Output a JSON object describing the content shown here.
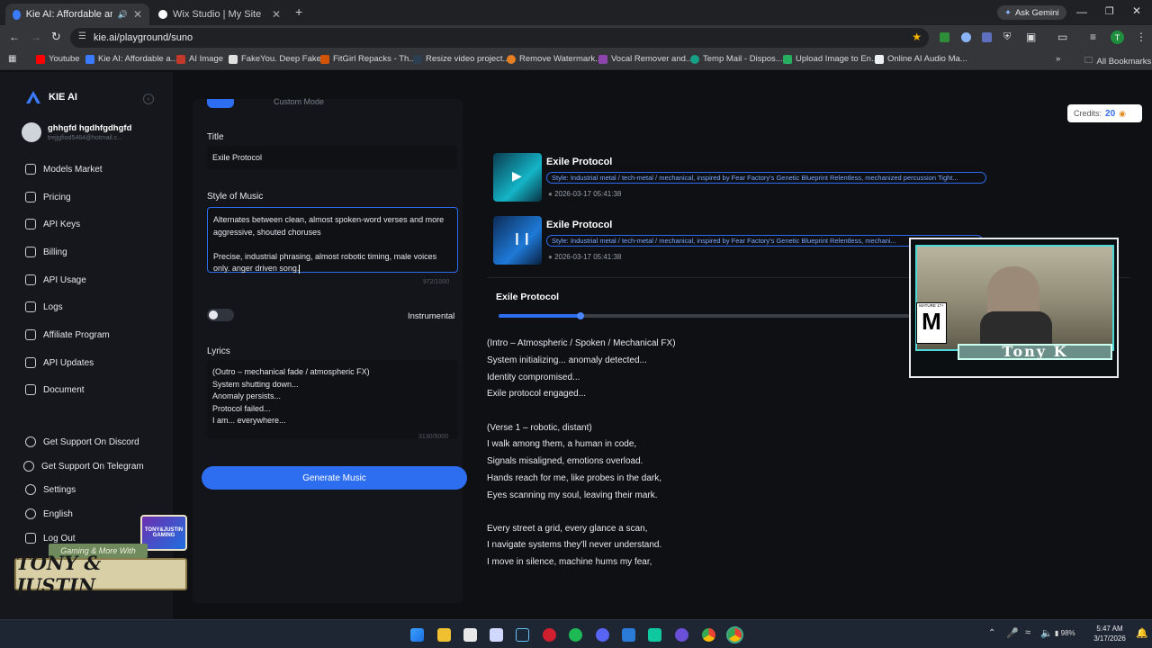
{
  "browser": {
    "tabs": [
      {
        "label": "Kie AI: Affordable and Stal"
      },
      {
        "label": "Wix Studio | My Site"
      }
    ],
    "new_tab_label": "+",
    "url": "kie.ai/playground/suno",
    "ask_gemini": "Ask Gemini",
    "profile_initial": "T",
    "bookmarks": [
      {
        "label": "Youtube"
      },
      {
        "label": "Kie AI: Affordable a..."
      },
      {
        "label": "AI Image"
      },
      {
        "label": "FakeYou. Deep Fake..."
      },
      {
        "label": "FitGirl Repacks - Th..."
      },
      {
        "label": "Resize video project..."
      },
      {
        "label": "Remove Watermark..."
      },
      {
        "label": "Vocal Remover and..."
      },
      {
        "label": "Temp Mail - Dispos..."
      },
      {
        "label": "Upload Image to En..."
      },
      {
        "label": "Online AI Audio Ma..."
      }
    ],
    "all_bookmarks": "All Bookmarks"
  },
  "sidebar": {
    "brand": "KIE AI",
    "user_name": "ghhgfd hgdhfgdhgfd",
    "user_email": "trejjgfiod5464@hotmail.c...",
    "nav": [
      {
        "label": "Models Market"
      },
      {
        "label": "Pricing"
      },
      {
        "label": "API Keys"
      },
      {
        "label": "Billing"
      },
      {
        "label": "API Usage"
      },
      {
        "label": "Logs"
      },
      {
        "label": "Affiliate Program"
      },
      {
        "label": "API Updates"
      },
      {
        "label": "Document"
      }
    ],
    "bottom": [
      {
        "label": "Get Support On Discord"
      },
      {
        "label": "Get Support On Telegram"
      },
      {
        "label": "Settings"
      },
      {
        "label": "English"
      },
      {
        "label": "Log Out"
      }
    ]
  },
  "form": {
    "custom_mode_label": "Custom Mode",
    "title_label": "Title",
    "title_value": "Exile Protocol",
    "style_label": "Style of Music",
    "style_lines": [
      "Alternates between clean, almost spoken-word verses and more",
      "aggressive, shouted choruses",
      "",
      "Precise, industrial phrasing, almost robotic timing, male voices",
      "only. anger driven song."
    ],
    "style_counter": "972/1000",
    "instrumental_label": "Instrumental",
    "lyrics_label": "Lyrics",
    "lyrics_lines": [
      "(Outro – mechanical fade / atmospheric FX)",
      "System shutting down...",
      "Anomaly persists...",
      "Protocol failed...",
      "I am... everywhere..."
    ],
    "lyrics_counter": "3130/5000",
    "generate_label": "Generate Music"
  },
  "credits": {
    "label": "Credits:",
    "value": "20"
  },
  "songs": [
    {
      "title": "Exile Protocol",
      "style": "Style: Industrial metal / tech-metal / mechanical, inspired by Fear Factory's Genetic Blueprint Relentless, mechanized percussion Tight...",
      "date": "2026-03-17 05:41:38"
    },
    {
      "title": "Exile Protocol",
      "style": "Style: Industrial metal / tech-metal / mechanical, inspired by Fear Factory's Genetic Blueprint Relentless, mechani...",
      "date": "2026-03-17 05:41:38"
    }
  ],
  "player": {
    "title": "Exile Protocol",
    "progress": 0.2
  },
  "lyrics_display": [
    "(Intro – Atmospheric / Spoken / Mechanical FX)",
    "System initializing... anomaly detected...",
    "Identity compromised...",
    "Exile protocol engaged...",
    "",
    "(Verse 1 – robotic, distant)",
    "I walk among them, a human in code,",
    "Signals misaligned, emotions overload.",
    "Hands reach for me, like probes in the dark,",
    "Eyes scanning my soul, leaving their mark.",
    "",
    "Every street a grid, every glance a scan,",
    "I navigate systems they'll never understand.",
    "I move in silence, machine hums my fear,"
  ],
  "overlay": {
    "webcam_name": "Tony K",
    "rating": "M",
    "rating_top": "MATURE 17+",
    "logo_line1": "Gaming & More With",
    "logo_line2": "TONY & JUSTIN",
    "logo_badge": "TONY&JUSTIN GAMING"
  },
  "taskbar": {
    "battery": "98%",
    "time": "5:47 AM",
    "date": "3/17/2026"
  },
  "colors": {
    "accent": "#2d6ef0",
    "pill_text": "#7aa6ff",
    "sidebar_bg": "#15171c",
    "app_bg": "#0e1014"
  }
}
